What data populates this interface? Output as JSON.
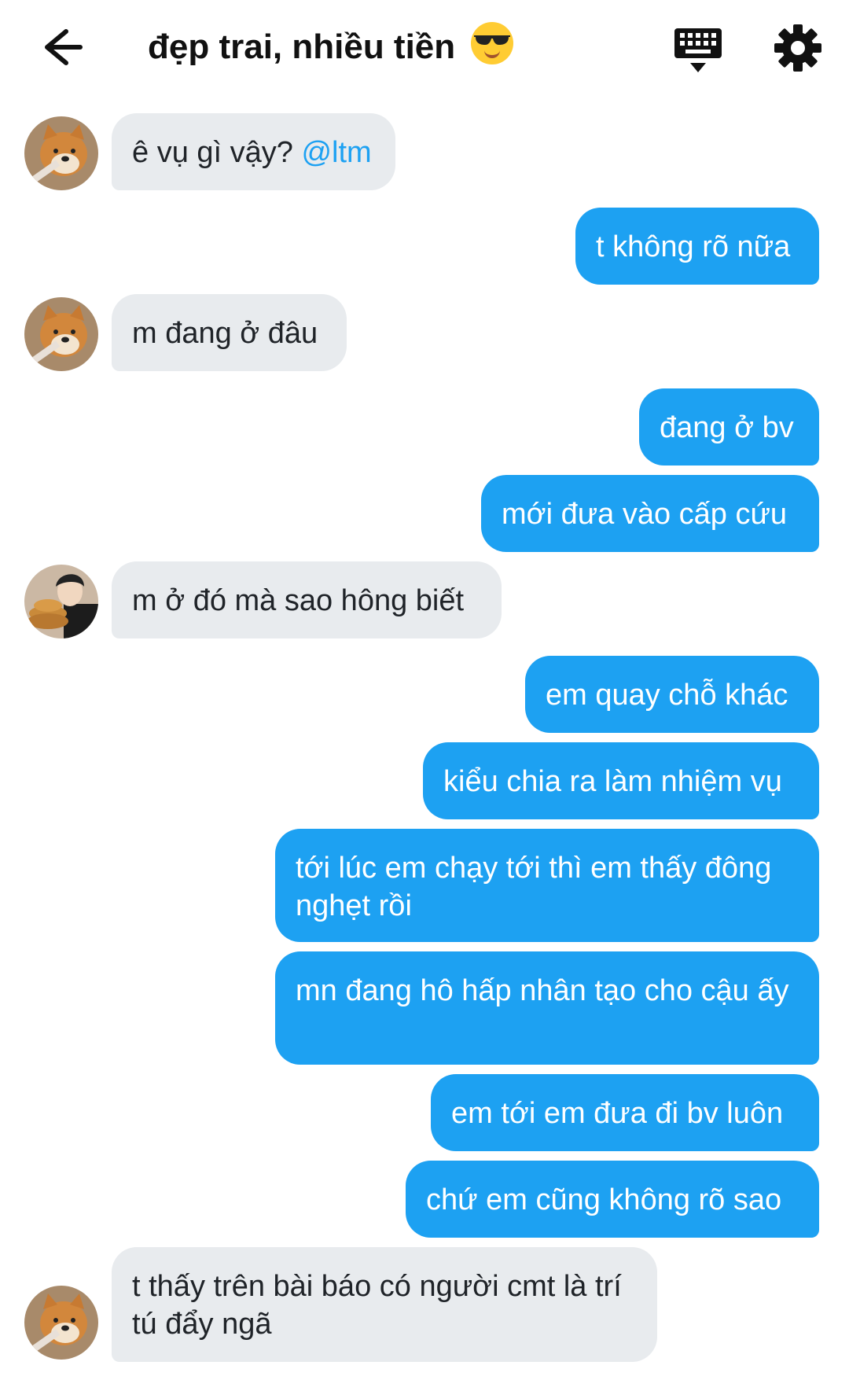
{
  "header": {
    "title": "đẹp trai, nhiều tiền",
    "back_icon": "back-arrow-icon",
    "keyboard_icon": "keyboard-icon",
    "settings_icon": "gear-icon"
  },
  "colors": {
    "outgoing_bubble": "#1da1f2",
    "incoming_bubble": "#e8ebee",
    "mention": "#1da1f2"
  },
  "messages": [
    {
      "side": "in",
      "text": "ê vụ gì vậy? ",
      "mention": "@ltm",
      "avatar": "shiba-avatar"
    },
    {
      "side": "out",
      "text": "t không rõ nữa"
    },
    {
      "side": "in",
      "text": "m đang ở đâu",
      "avatar": "shiba-avatar"
    },
    {
      "side": "out",
      "text": "đang ở bv"
    },
    {
      "side": "out",
      "text": "mới đưa vào cấp cứu"
    },
    {
      "side": "in",
      "text": "m ở đó mà sao hông biết",
      "avatar": "person-cake-avatar"
    },
    {
      "side": "out",
      "text": "em quay chỗ khác"
    },
    {
      "side": "out",
      "text": "kiểu chia ra làm nhiệm vụ"
    },
    {
      "side": "out",
      "text": "tới lúc em chạy tới thì em thấy đông nghẹt rồi"
    },
    {
      "side": "out",
      "text": "mn đang hô hấp nhân tạo cho cậu ấy"
    },
    {
      "side": "out",
      "text": "em tới em đưa đi bv luôn"
    },
    {
      "side": "out",
      "text": "chứ em cũng không rõ sao"
    },
    {
      "side": "in",
      "text": "t thấy trên bài báo có người cmt là trí tú đẩy ngã",
      "avatar": "shiba-avatar"
    }
  ]
}
